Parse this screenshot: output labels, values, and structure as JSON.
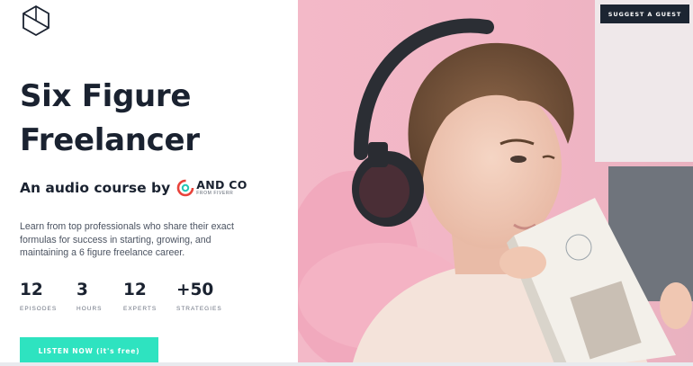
{
  "header": {
    "logo_icon": "cube-outline-icon",
    "suggest_label": "SUGGEST A GUEST"
  },
  "hero": {
    "title_line1": "Six Figure",
    "title_line2": "Freelancer",
    "byline": "An audio course by",
    "brand_name": "AND CO",
    "brand_subtitle": "FROM FIVERR",
    "description": "Learn from top professionals who share their exact formulas for success in starting, growing, and maintaining a 6 figure freelance career.",
    "cta_label": "LISTEN NOW (it's free)"
  },
  "stats": [
    {
      "value": "12",
      "label": "EPISODES"
    },
    {
      "value": "3",
      "label": "HOURS"
    },
    {
      "value": "12",
      "label": "EXPERTS"
    },
    {
      "value": "+50",
      "label": "STRATEGIES"
    }
  ],
  "colors": {
    "accent": "#2ee3c0",
    "dark": "#1c2532",
    "brand_red": "#e8433b",
    "brand_teal": "#23c7b6",
    "pink_background": "#f0b6c6"
  },
  "photo": {
    "subject": "hero-photo"
  }
}
